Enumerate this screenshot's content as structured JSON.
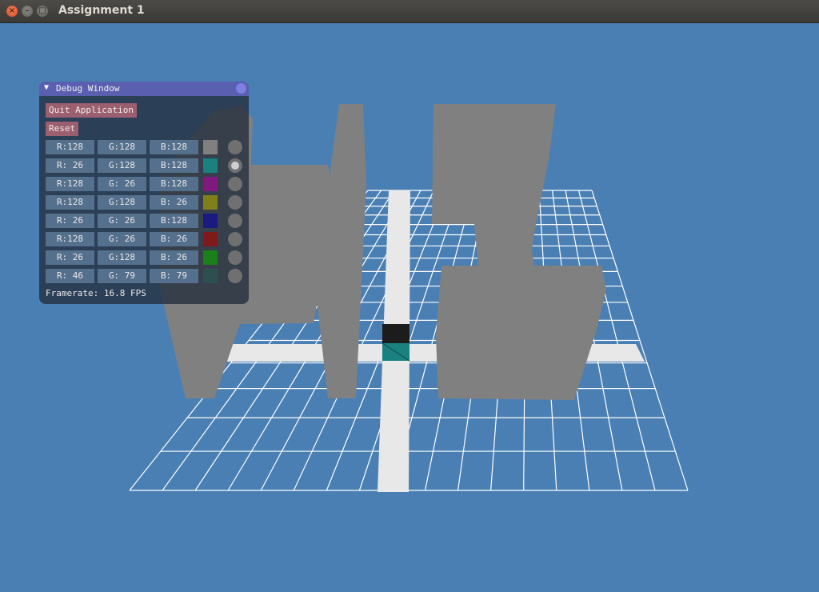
{
  "window": {
    "title": "Assignment 1",
    "buttons": {
      "close": "×",
      "minimize": "–",
      "maximize": "□"
    }
  },
  "scene": {
    "background": "#4a7fb4",
    "grid_color": "#ffffff",
    "path_color": "#e8e8e8",
    "wall_color": "#808080",
    "agent_top_color": "#1c1c1c",
    "agent_color": "#1a8080"
  },
  "debug": {
    "title": "Debug Window",
    "collapse_icon": "▼",
    "quit_label": "Quit Application",
    "reset_label": "Reset",
    "rows": [
      {
        "r": "R:128",
        "g": "G:128",
        "b": "B:128",
        "color": "#808080",
        "selected": false
      },
      {
        "r": "R: 26",
        "g": "G:128",
        "b": "B:128",
        "color": "#1a8080",
        "selected": true
      },
      {
        "r": "R:128",
        "g": "G: 26",
        "b": "B:128",
        "color": "#801a80",
        "selected": false
      },
      {
        "r": "R:128",
        "g": "G:128",
        "b": "B: 26",
        "color": "#80801a",
        "selected": false
      },
      {
        "r": "R: 26",
        "g": "G: 26",
        "b": "B:128",
        "color": "#1a1a80",
        "selected": false
      },
      {
        "r": "R:128",
        "g": "G: 26",
        "b": "B: 26",
        "color": "#801a1a",
        "selected": false
      },
      {
        "r": "R: 26",
        "g": "G:128",
        "b": "B: 26",
        "color": "#1a801a",
        "selected": false
      },
      {
        "r": "R: 46",
        "g": "G: 79",
        "b": "B: 79",
        "color": "#2e4f4f",
        "selected": false
      }
    ],
    "framerate": "Framerate: 16.8 FPS"
  }
}
